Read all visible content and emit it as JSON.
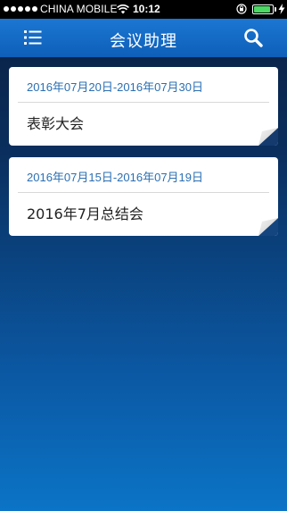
{
  "status_bar": {
    "carrier": "CHINA MOBILE",
    "time": "10:12",
    "battery_level": 0.9
  },
  "nav": {
    "title": "会议助理",
    "menu_icon": "list-menu-icon",
    "search_icon": "search-icon"
  },
  "meetings": [
    {
      "date_range": "2016年07月20日-2016年07月30日",
      "title": "表彰大会"
    },
    {
      "date_range": "2016年07月15日-2016年07月19日",
      "title": "2016年7月总结会"
    }
  ],
  "colors": {
    "nav_bar": "#1b77d3",
    "date_text": "#2a6fb3",
    "battery": "#4cd964"
  }
}
